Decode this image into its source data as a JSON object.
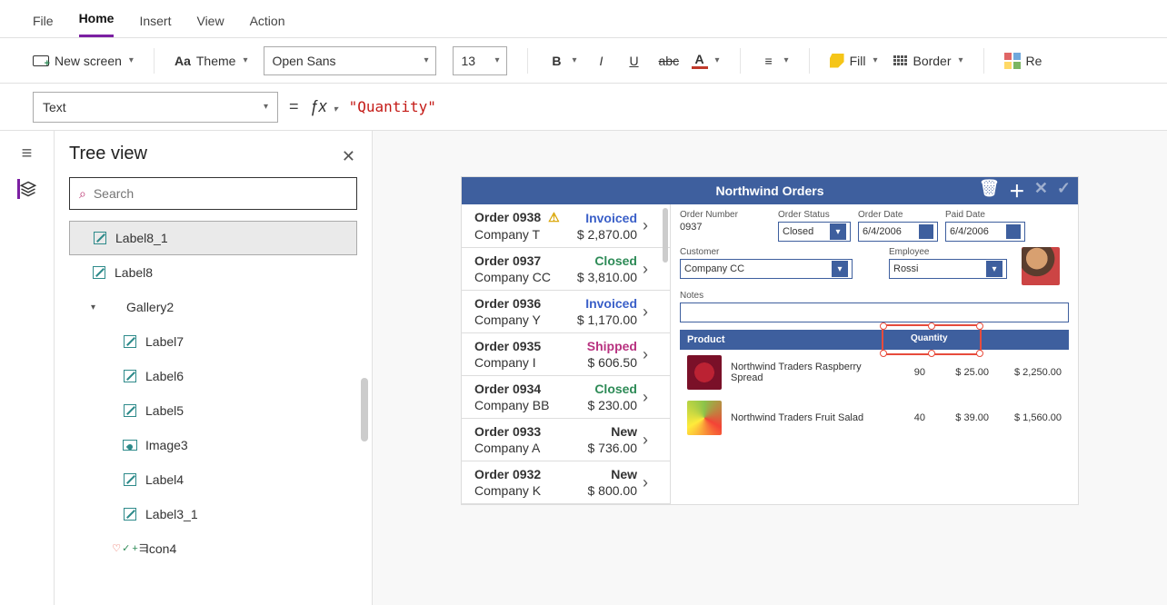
{
  "menu": {
    "items": [
      "File",
      "Home",
      "Insert",
      "View",
      "Action"
    ],
    "active": "Home"
  },
  "toolbar": {
    "newScreen": "New screen",
    "theme": "Theme",
    "font": "Open Sans",
    "fontSize": "13",
    "fill": "Fill",
    "border": "Border",
    "reorder": "Re"
  },
  "formulaBar": {
    "property": "Text",
    "formula": "\"Quantity\""
  },
  "treeView": {
    "title": "Tree view",
    "searchPlaceholder": "Search",
    "items": [
      {
        "name": "Label8_1",
        "type": "label",
        "selected": true,
        "indent": 0
      },
      {
        "name": "Label8",
        "type": "label",
        "indent": 0
      },
      {
        "name": "Gallery2",
        "type": "gallery",
        "indent": 0,
        "expanded": true
      },
      {
        "name": "Label7",
        "type": "label",
        "indent": 1
      },
      {
        "name": "Label6",
        "type": "label",
        "indent": 1
      },
      {
        "name": "Label5",
        "type": "label",
        "indent": 1
      },
      {
        "name": "Image3",
        "type": "image",
        "indent": 1
      },
      {
        "name": "Label4",
        "type": "label",
        "indent": 1
      },
      {
        "name": "Label3_1",
        "type": "label",
        "indent": 1
      },
      {
        "name": "Icon4",
        "type": "icon",
        "indent": 1
      }
    ]
  },
  "canvasApp": {
    "title": "Northwind Orders",
    "orders": [
      {
        "num": "Order 0938",
        "company": "Company T",
        "status": "Invoiced",
        "statusClass": "inv",
        "amount": "$ 2,870.00",
        "warn": true
      },
      {
        "num": "Order 0937",
        "company": "Company CC",
        "status": "Closed",
        "statusClass": "cls",
        "amount": "$ 3,810.00"
      },
      {
        "num": "Order 0936",
        "company": "Company Y",
        "status": "Invoiced",
        "statusClass": "inv",
        "amount": "$ 1,170.00"
      },
      {
        "num": "Order 0935",
        "company": "Company I",
        "status": "Shipped",
        "statusClass": "shp",
        "amount": "$ 606.50"
      },
      {
        "num": "Order 0934",
        "company": "Company BB",
        "status": "Closed",
        "statusClass": "cls",
        "amount": "$ 230.00"
      },
      {
        "num": "Order 0933",
        "company": "Company A",
        "status": "New",
        "statusClass": "new",
        "amount": "$ 736.00"
      },
      {
        "num": "Order 0932",
        "company": "Company K",
        "status": "New",
        "statusClass": "new",
        "amount": "$ 800.00"
      }
    ],
    "detail": {
      "labels": {
        "orderNumber": "Order Number",
        "orderStatus": "Order Status",
        "orderDate": "Order Date",
        "paidDate": "Paid Date",
        "customer": "Customer",
        "employee": "Employee",
        "notes": "Notes",
        "product": "Product",
        "quantity": "Quantity"
      },
      "orderNumber": "0937",
      "orderStatus": "Closed",
      "orderDate": "6/4/2006",
      "paidDate": "6/4/2006",
      "customer": "Company CC",
      "employee": "Rossi",
      "notes": ""
    },
    "products": [
      {
        "name": "Northwind Traders Raspberry Spread",
        "qty": "90",
        "price": "$ 25.00",
        "total": "$ 2,250.00",
        "img": "berry"
      },
      {
        "name": "Northwind Traders Fruit Salad",
        "qty": "40",
        "price": "$ 39.00",
        "total": "$ 1,560.00",
        "img": "salad"
      }
    ]
  }
}
